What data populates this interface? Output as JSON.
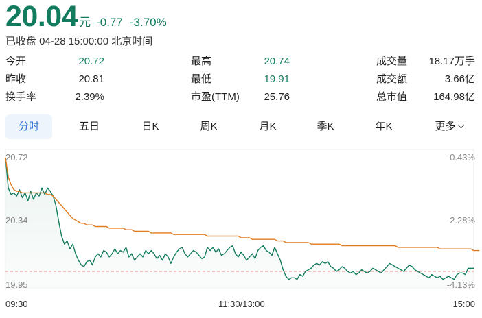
{
  "quote": {
    "price": "20.04",
    "unit": "元",
    "change": "-0.77",
    "change_pct": "-3.70%",
    "status": "已收盘 04-28 15:00:00 北京时间"
  },
  "stats": [
    [
      {
        "label": "今开",
        "value": "20.72",
        "color": "green"
      },
      {
        "label": "最高",
        "value": "20.74",
        "color": "green"
      },
      {
        "label": "成交量",
        "value": "18.17万手",
        "color": "dark"
      }
    ],
    [
      {
        "label": "昨收",
        "value": "20.81",
        "color": "dark"
      },
      {
        "label": "最低",
        "value": "19.91",
        "color": "green"
      },
      {
        "label": "成交额",
        "value": "3.66亿",
        "color": "dark"
      }
    ],
    [
      {
        "label": "换手率",
        "value": "2.39%",
        "color": "dark"
      },
      {
        "label": "市盈(TTM)",
        "value": "25.76",
        "color": "dark"
      },
      {
        "label": "总市值",
        "value": "164.98亿",
        "color": "dark"
      }
    ]
  ],
  "tabs": [
    {
      "label": "分时",
      "active": true
    },
    {
      "label": "五日"
    },
    {
      "label": "日K"
    },
    {
      "label": "周K"
    },
    {
      "label": "月K"
    },
    {
      "label": "季K"
    },
    {
      "label": "年K"
    },
    {
      "label": "更多"
    }
  ],
  "colors": {
    "accent_green": "#137c5e",
    "price_line": "#137c5e",
    "avg_line": "#e07b1f",
    "prev_close_line": "#e88a8a",
    "tab_active": "#2d6ed0"
  },
  "chart_data": {
    "type": "line",
    "y_left_labels": [
      "20.72",
      "20.34",
      "19.95"
    ],
    "y_right_labels": [
      "-0.43%",
      "-2.28%",
      "-4.13%"
    ],
    "x_labels": [
      "09:30",
      "11:30/13:00",
      "15:00"
    ],
    "ylim": [
      19.95,
      20.72
    ],
    "prev_close": 20.81,
    "series": [
      {
        "values": [
          20.72,
          20.53,
          20.49,
          20.5,
          20.48,
          20.52,
          20.47,
          20.5,
          20.45,
          20.51,
          20.46,
          20.5,
          20.48,
          20.53,
          20.49,
          20.53,
          20.51,
          20.48,
          20.42,
          20.32,
          20.23,
          20.18,
          20.2,
          20.15,
          20.18,
          20.12,
          20.08,
          20.05,
          20.04,
          20.07,
          20.08,
          20.05,
          20.1,
          20.12,
          20.1,
          20.14,
          20.13,
          20.1,
          20.12,
          20.15,
          20.12,
          20.14,
          20.13,
          20.16,
          20.1,
          20.12,
          20.08,
          20.1,
          20.12,
          20.1,
          20.14,
          20.12,
          20.14,
          20.12,
          20.09,
          20.11,
          20.08,
          20.12,
          20.1,
          20.06,
          20.1,
          20.13,
          20.15,
          20.16,
          20.12,
          20.1,
          20.12,
          20.14,
          20.13,
          20.11,
          20.09,
          20.1,
          20.16,
          20.14,
          20.16,
          20.13,
          20.15,
          20.11,
          20.12,
          20.14,
          20.16,
          20.17,
          20.12,
          20.1,
          20.13,
          20.11,
          20.08,
          20.1,
          20.12,
          20.09,
          20.14,
          20.16,
          20.17,
          20.14,
          20.13,
          20.11,
          20.16,
          20.12,
          20.08,
          20.02,
          19.98,
          19.96,
          19.97,
          19.97,
          19.96,
          19.99,
          19.98,
          20.01,
          20.02,
          20.03,
          20.05,
          20.06,
          20.05,
          20.07,
          20.06,
          20.07,
          20.04,
          20.03,
          20.01,
          20.02,
          20.04,
          20.03,
          20.01,
          20.0,
          20.01,
          19.99,
          20.0,
          20.02,
          20.01,
          20.0,
          20.01,
          20.03,
          20.02,
          20.01,
          20.0,
          20.02,
          20.04,
          20.06,
          20.05,
          20.04,
          20.03,
          20.02,
          20.01,
          20.03,
          20.05,
          20.04,
          20.02,
          20.01,
          20.0,
          19.99,
          19.98,
          19.97,
          19.99,
          19.98,
          19.97,
          19.98,
          19.96,
          19.97,
          19.98,
          19.97,
          19.96,
          19.99,
          20.0,
          20.0,
          19.99,
          20.03,
          20.03,
          20.03
        ],
        "color": "#137c5e"
      },
      {
        "values": [
          20.72,
          20.6,
          20.55,
          20.52,
          20.51,
          20.51,
          20.5,
          20.5,
          20.5,
          20.5,
          20.5,
          20.5,
          20.5,
          20.5,
          20.5,
          20.49,
          20.49,
          20.48,
          20.46,
          20.44,
          20.42,
          20.4,
          20.38,
          20.36,
          20.34,
          20.33,
          20.32,
          20.31,
          20.31,
          20.3,
          20.3,
          20.3,
          20.29,
          20.29,
          20.29,
          20.29,
          20.29,
          20.28,
          20.28,
          20.28,
          20.28,
          20.28,
          20.28,
          20.27,
          20.27,
          20.27,
          20.26,
          20.26,
          20.26,
          20.26,
          20.26,
          20.26,
          20.25,
          20.25,
          20.25,
          20.25,
          20.25,
          20.25,
          20.25,
          20.25,
          20.24,
          20.24,
          20.24,
          20.24,
          20.24,
          20.24,
          20.24,
          20.24,
          20.24,
          20.24,
          20.24,
          20.24,
          20.23,
          20.23,
          20.23,
          20.23,
          20.23,
          20.23,
          20.23,
          20.23,
          20.23,
          20.23,
          20.23,
          20.23,
          20.22,
          20.22,
          20.22,
          20.22,
          20.21,
          20.21,
          20.21,
          20.21,
          20.21,
          20.21,
          20.21,
          20.21,
          20.21,
          20.2,
          20.2,
          20.2,
          20.19,
          20.19,
          20.19,
          20.19,
          20.19,
          20.19,
          20.19,
          20.19,
          20.19,
          20.18,
          20.18,
          20.18,
          20.18,
          20.18,
          20.18,
          20.18,
          20.18,
          20.18,
          20.18,
          20.18,
          20.17,
          20.17,
          20.17,
          20.17,
          20.17,
          20.17,
          20.17,
          20.17,
          20.17,
          20.17,
          20.17,
          20.17,
          20.17,
          20.17,
          20.17,
          20.17,
          20.17,
          20.17,
          20.17,
          20.17,
          20.16,
          20.16,
          20.16,
          20.16,
          20.16,
          20.16,
          20.16,
          20.16,
          20.16,
          20.16,
          20.16,
          20.16,
          20.16,
          20.16,
          20.16,
          20.15,
          20.15,
          20.15,
          20.15,
          20.15,
          20.15,
          20.15,
          20.15,
          20.15,
          20.15,
          20.15,
          20.15,
          20.14,
          20.14,
          20.14
        ],
        "color": "#e07b1f"
      }
    ]
  }
}
